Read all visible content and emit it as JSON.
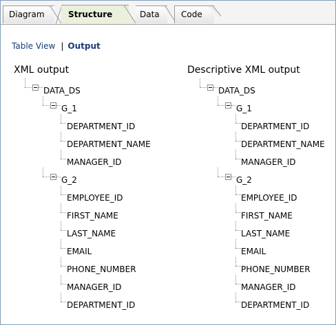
{
  "tabs": [
    {
      "label": "Diagram",
      "active": false
    },
    {
      "label": "Structure",
      "active": true
    },
    {
      "label": "Data",
      "active": false
    },
    {
      "label": "Code",
      "active": false
    }
  ],
  "view_links": {
    "table_view": "Table View",
    "separator": "|",
    "output": "Output"
  },
  "panels": [
    {
      "title": "XML output",
      "root": "DATA_DS",
      "groups": [
        {
          "name": "G_1",
          "fields": [
            "DEPARTMENT_ID",
            "DEPARTMENT_NAME",
            "MANAGER_ID"
          ]
        },
        {
          "name": "G_2",
          "fields": [
            "EMPLOYEE_ID",
            "FIRST_NAME",
            "LAST_NAME",
            "EMAIL",
            "PHONE_NUMBER",
            "MANAGER_ID",
            "DEPARTMENT_ID"
          ]
        }
      ]
    },
    {
      "title": "Descriptive XML output",
      "root": "DATA_DS",
      "groups": [
        {
          "name": "G_1",
          "fields": [
            "DEPARTMENT_ID",
            "DEPARTMENT_NAME",
            "MANAGER_ID"
          ]
        },
        {
          "name": "G_2",
          "fields": [
            "EMPLOYEE_ID",
            "FIRST_NAME",
            "LAST_NAME",
            "EMAIL",
            "PHONE_NUMBER",
            "MANAGER_ID",
            "DEPARTMENT_ID"
          ]
        }
      ]
    }
  ],
  "colors": {
    "active_tab": "#eaf0dc",
    "link": "#1a3c7a",
    "border": "#7f9db9"
  }
}
